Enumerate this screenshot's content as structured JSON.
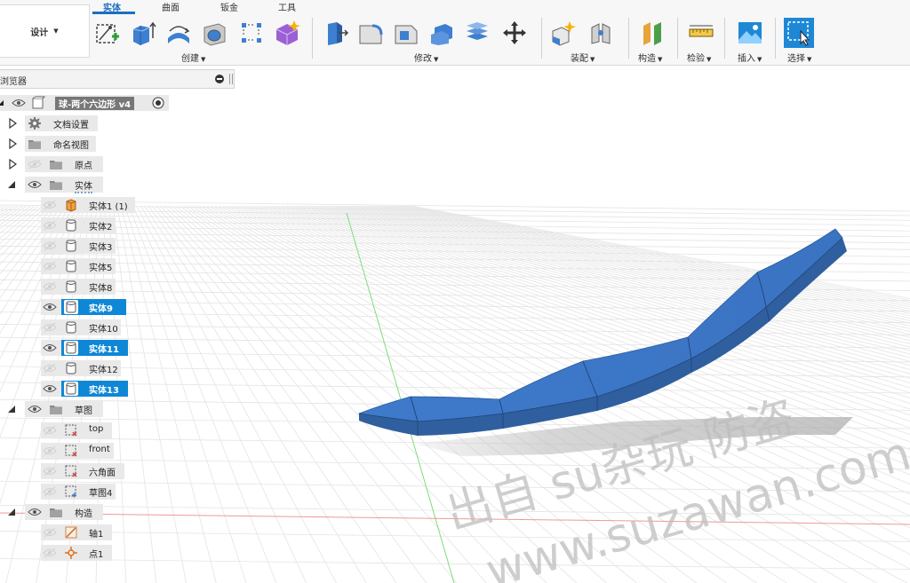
{
  "toolbar": {
    "workspace": "设计",
    "tabs": [
      "实体",
      "曲面",
      "钣金",
      "工具"
    ],
    "active_tab": "实体",
    "groups": [
      {
        "label": "创建"
      },
      {
        "label": "修改"
      },
      {
        "label": "装配"
      },
      {
        "label": "构造"
      },
      {
        "label": "检验"
      },
      {
        "label": "插入"
      },
      {
        "label": "选择"
      }
    ]
  },
  "browser": {
    "title": "浏览器",
    "root": "球-两个六边形 v4",
    "items": [
      {
        "label": "文档设置"
      },
      {
        "label": "命名视图"
      },
      {
        "label": "原点"
      },
      {
        "label": "实体"
      },
      {
        "label": "实体1 (1)"
      },
      {
        "label": "实体2"
      },
      {
        "label": "实体3"
      },
      {
        "label": "实体5"
      },
      {
        "label": "实体8"
      },
      {
        "label": "实体9"
      },
      {
        "label": "实体10"
      },
      {
        "label": "实体11"
      },
      {
        "label": "实体12"
      },
      {
        "label": "实体13"
      },
      {
        "label": "草图"
      },
      {
        "label": "top"
      },
      {
        "label": "front"
      },
      {
        "label": "六角面"
      },
      {
        "label": "草图4"
      },
      {
        "label": "构造"
      },
      {
        "label": "轴1"
      },
      {
        "label": "点1"
      }
    ]
  },
  "watermark": {
    "line1": "出自 su杂玩 防盗",
    "line2": "www.suzawan.com"
  },
  "colors": {
    "accent": "#0e87d6",
    "body_blue": "#3d78c6",
    "body_edge": "#2a5b9e"
  }
}
